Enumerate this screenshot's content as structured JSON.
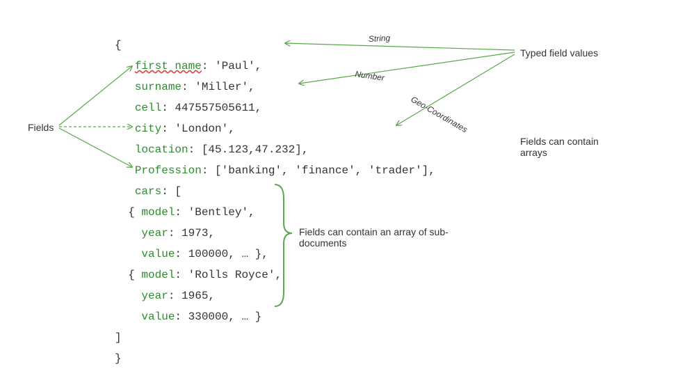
{
  "labels": {
    "fields": "Fields",
    "typed_values": "Typed field values",
    "arrays_note": "Fields can contain arrays",
    "subdocs_note": "Fields can contain an array of sub-documents",
    "type_string": "String",
    "type_number": "Number",
    "type_geo": "Geo-Coordinates"
  },
  "code": {
    "open_brace": "{",
    "close_brace": "}",
    "close_bracket": "]",
    "line1_key": "first name",
    "line1_val": ": 'Paul',",
    "line2_key": "surname",
    "line2_val": ": 'Miller',",
    "line3_key": "cell",
    "line3_val": ": 447557505611,",
    "line4_key": "city",
    "line4_val": ": 'London',",
    "line5_key": "location",
    "line5_val": ": [45.123,47.232],",
    "line6_key": "Profession",
    "line6_val": ": ['banking', 'finance', 'trader'],",
    "line7_key": "cars",
    "line7_val": ": [",
    "car1_open": "  { ",
    "car1_model_key": "model",
    "car1_model_val": ": 'Bentley',",
    "car1_year_key": "year",
    "car1_year_val": ": 1973,",
    "car1_value_key": "value",
    "car1_value_val": ": 100000, … },",
    "car2_open": "  { ",
    "car2_model_key": "model",
    "car2_model_val": ": 'Rolls Royce',",
    "car2_year_key": "year",
    "car2_year_val": ": 1965,",
    "car2_value_key": "value",
    "car2_value_val": ": 330000, … }"
  }
}
